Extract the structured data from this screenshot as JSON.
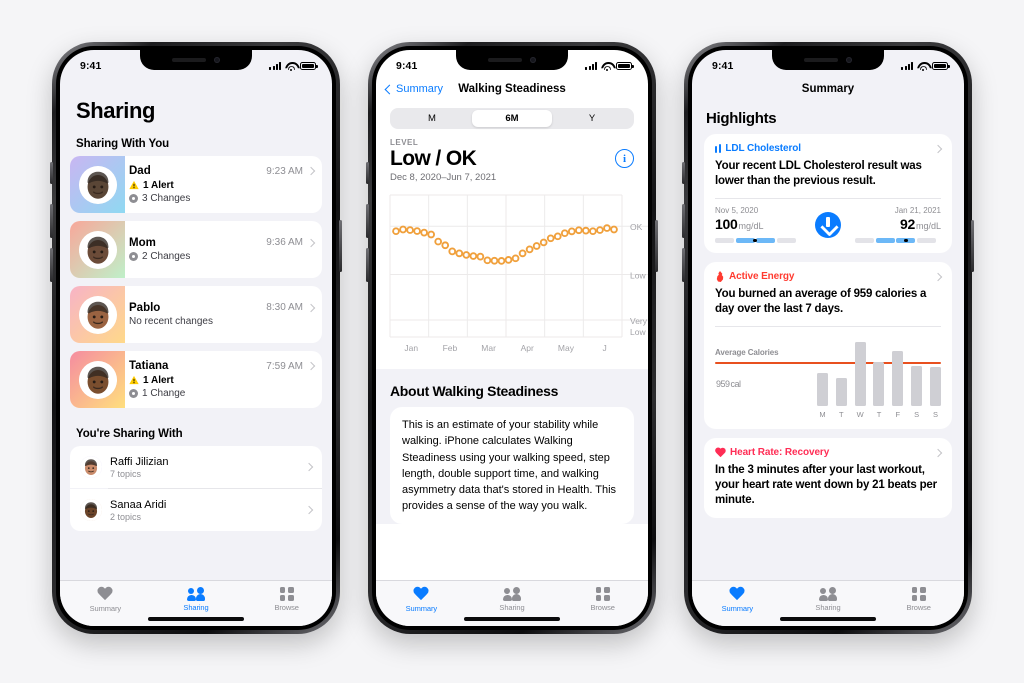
{
  "colors": {
    "accent_blue": "#0a7cff",
    "page_background": "#f5f5f7",
    "screen_background": "#f2f2f7",
    "card_white": "#ffffff",
    "muted_gray": "#8e8e93",
    "energy_orange": "#e8501f",
    "heart_red": "#ff2d55",
    "chart_orange": "#f0a martin"
  },
  "phone1": {
    "status": {
      "time": "9:41",
      "signal_icon": "cellular-bars-icon",
      "wifi_icon": "wifi-icon",
      "battery_icon": "battery-icon"
    },
    "title": "Sharing",
    "sections": [
      {
        "heading": "Sharing With You",
        "rows": [
          {
            "name": "Dad",
            "time": "9:23 AM",
            "lines": [
              {
                "icon": "warning-triangle-icon",
                "text": "1 Alert",
                "bold": true
              },
              {
                "icon": "change-dot-icon",
                "text": "3 Changes",
                "bold": false
              }
            ],
            "avatar": "memoji-dad",
            "grad_from": "#c9b6f2",
            "grad_to": "#8fd9f2",
            "face": "#5a4636"
          },
          {
            "name": "Mom",
            "time": "9:36 AM",
            "lines": [
              {
                "icon": "change-dot-icon",
                "text": "2 Changes",
                "bold": false
              }
            ],
            "avatar": "memoji-mom",
            "grad_from": "#f8a79a",
            "grad_to": "#bff0c9",
            "face": "#6b4b38"
          },
          {
            "name": "Pablo",
            "time": "8:30 AM",
            "lines": [
              {
                "icon": "",
                "text": "No recent changes",
                "bold": false
              }
            ],
            "avatar": "memoji-pablo",
            "grad_from": "#f7b3c6",
            "grad_to": "#ffd98a",
            "face": "#9a6341"
          },
          {
            "name": "Tatiana",
            "time": "7:59 AM",
            "lines": [
              {
                "icon": "warning-triangle-icon",
                "text": "1 Alert",
                "bold": true
              },
              {
                "icon": "change-dot-icon",
                "text": "1 Change",
                "bold": false
              }
            ],
            "avatar": "memoji-tatiana",
            "grad_from": "#f58ca0",
            "grad_to": "#ffdf7e",
            "face": "#7a4e2e"
          }
        ]
      },
      {
        "heading": "You're Sharing With",
        "plain_rows": [
          {
            "name": "Raffi Jilizian",
            "sub": "7 topics",
            "avatar": "memoji-raffi",
            "bg": "#e3ddf6",
            "face": "#c98b6b"
          },
          {
            "name": "Sanaa Aridi",
            "sub": "2 topics",
            "avatar": "memoji-sanaa",
            "bg": "#f0ded0",
            "face": "#6b4429"
          }
        ]
      }
    ],
    "tabs": [
      {
        "label": "Summary",
        "icon": "heart-icon",
        "active": false
      },
      {
        "label": "Sharing",
        "icon": "people-icon",
        "active": true
      },
      {
        "label": "Browse",
        "icon": "grid-icon",
        "active": false
      }
    ]
  },
  "phone2": {
    "status": {
      "time": "9:41"
    },
    "nav": {
      "back_label": "Summary",
      "title": "Walking Steadiness"
    },
    "segmented": {
      "options": [
        "M",
        "6M",
        "Y"
      ],
      "selected": "6M"
    },
    "level": {
      "caption": "LEVEL",
      "value": "Low / OK",
      "date_range": "Dec 8, 2020–Jun 7, 2021",
      "info_icon": "info-circle-icon"
    },
    "about": {
      "heading": "About Walking Steadiness",
      "body": "This is an estimate of your stability while walking. iPhone calculates Walking Steadiness using your walking speed, step length, double support time, and walking asymmetry data that's stored in Health. This provides a sense of the way you walk."
    },
    "tabs": [
      {
        "label": "Summary",
        "icon": "heart-icon",
        "active": true
      },
      {
        "label": "Sharing",
        "icon": "people-icon",
        "active": false
      },
      {
        "label": "Browse",
        "icon": "grid-icon",
        "active": false
      }
    ]
  },
  "phone3": {
    "status": {
      "time": "9:41"
    },
    "nav_title": "Summary",
    "section_heading": "Highlights",
    "cards": [
      {
        "id": "ldl-cholesterol",
        "title": "LDL Cholesterol",
        "title_color": "#0a7cff",
        "icon": "bar-chart-icon",
        "body": "Your recent LDL Cholesterol result was lower than the previous result.",
        "comparison": {
          "left": {
            "date": "Nov 5, 2020",
            "value": "100",
            "unit": "mg/dL",
            "marker_pos": 0.47
          },
          "right": {
            "date": "Jan 21, 2021",
            "value": "92",
            "unit": "mg/dL",
            "marker_pos": 0.58
          },
          "arrow_icon": "arrow-down-circle-icon"
        }
      },
      {
        "id": "active-energy",
        "title": "Active Energy",
        "title_color": "#ff3b30",
        "icon": "flame-icon",
        "body": "You burned an average of 959 calories a day over the last 7 days.",
        "chart_label": "Average Calories",
        "average_value": "959",
        "average_unit": "cal"
      },
      {
        "id": "heart-rate-recovery",
        "title": "Heart Rate: Recovery",
        "title_color": "#ff2d55",
        "icon": "heart-icon",
        "body": "In the 3 minutes after your last workout, your heart rate went down by 21 beats per minute."
      }
    ],
    "tabs": [
      {
        "label": "Summary",
        "icon": "heart-icon",
        "active": true
      },
      {
        "label": "Sharing",
        "icon": "people-icon",
        "active": false
      },
      {
        "label": "Browse",
        "icon": "grid-icon",
        "active": false
      }
    ]
  },
  "chart_data": [
    {
      "id": "walking-steadiness-chart",
      "type": "scatter",
      "title": "Walking Steadiness",
      "xlabel": "",
      "ylabel": "",
      "x_tick_labels": [
        "Jan",
        "Feb",
        "Mar",
        "Apr",
        "May",
        "J"
      ],
      "y_tick_labels": [
        "OK",
        "Low",
        "Very Low"
      ],
      "y_tick_values": [
        0.78,
        0.44,
        0.12
      ],
      "ylim": [
        0,
        1
      ],
      "grid": true,
      "point_color": "#f0a03c",
      "point_style": "open-circle",
      "values": [
        0.745,
        0.757,
        0.753,
        0.746,
        0.735,
        0.722,
        0.672,
        0.646,
        0.603,
        0.589,
        0.578,
        0.57,
        0.566,
        0.54,
        0.537,
        0.536,
        0.543,
        0.554,
        0.589,
        0.617,
        0.641,
        0.666,
        0.695,
        0.709,
        0.731,
        0.744,
        0.752,
        0.749,
        0.745,
        0.753,
        0.767,
        0.757
      ]
    },
    {
      "id": "active-energy-chart",
      "type": "bar",
      "title": "Average Calories",
      "categories": [
        "M",
        "T",
        "W",
        "T",
        "F",
        "S",
        "S"
      ],
      "values": [
        760,
        640,
        1450,
        1010,
        1250,
        900,
        890
      ],
      "average_line": 959,
      "ylim": [
        0,
        1500
      ],
      "bar_color": "#cfcfd4",
      "line_color": "#e8501f",
      "grid": false
    }
  ]
}
